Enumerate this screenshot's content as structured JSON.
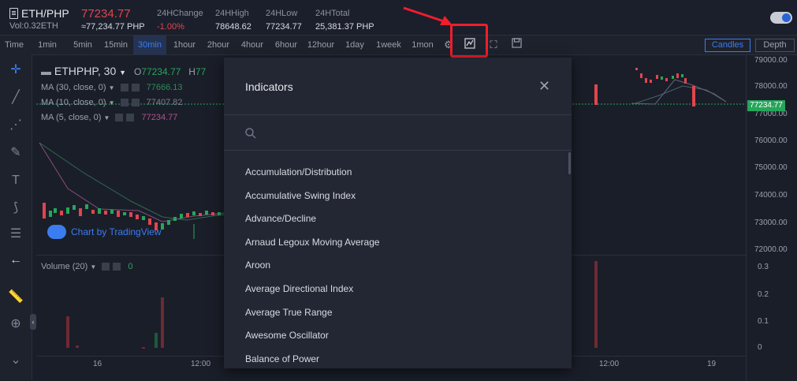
{
  "header": {
    "pair": "ETH/PHP",
    "last_price": "77234.77",
    "vol": "Vol:0.32ETH",
    "approx": "≈77,234.77 PHP",
    "stats": [
      {
        "label": "24HChange",
        "value": "-1.00%"
      },
      {
        "label": "24HHigh",
        "value": "78648.62"
      },
      {
        "label": "24HLow",
        "value": "77234.77"
      },
      {
        "label": "24HTotal",
        "value": "25,381.37 PHP"
      }
    ]
  },
  "timeframes": [
    "Time",
    "1min",
    "5min",
    "15min",
    "30min",
    "1hour",
    "2hour",
    "4hour",
    "6hour",
    "12hour",
    "1day",
    "1week",
    "1mon"
  ],
  "active_timeframe": "30min",
  "toolbar": {
    "candles_label": "Candles",
    "depth_label": "Depth"
  },
  "chart": {
    "symbol_label": "ETHPHP, 30",
    "ohlc_prefix": "O",
    "ohlc_value": "77234.77",
    "ohlc_h_prefix": "H",
    "ohlc_h_value": "77",
    "ma_lines": [
      {
        "label": "MA (30, close, 0)",
        "value": "77666.13",
        "color": "#2e8b57"
      },
      {
        "label": "MA (10, close, 0)",
        "value": "77407.82",
        "color": "#7a7f8c"
      },
      {
        "label": "MA (5, close, 0)",
        "value": "77234.77",
        "color": "#b05090"
      }
    ],
    "watermark": "Chart by TradingView",
    "volume_label": "Volume (20)",
    "volume_value": "0",
    "current_price_label": "77234.77",
    "price_ticks": [
      "79000.00",
      "78000.00",
      "77000.00",
      "76000.00",
      "75000.00",
      "74000.00",
      "73000.00",
      "72000.00"
    ],
    "volume_ticks": [
      "0.3",
      "0.2",
      "0.1",
      "0"
    ],
    "time_ticks": [
      "16",
      "12:00",
      "12:00",
      "19"
    ]
  },
  "indicators_modal": {
    "title": "Indicators",
    "items": [
      "Accumulation/Distribution",
      "Accumulative Swing Index",
      "Advance/Decline",
      "Arnaud Legoux Moving Average",
      "Aroon",
      "Average Directional Index",
      "Average True Range",
      "Awesome Oscillator",
      "Balance of Power"
    ]
  },
  "colors": {
    "up": "#26a65b",
    "down": "#e0464e",
    "accent": "#3b7cf0",
    "highlight_box": "#f01e2d"
  }
}
